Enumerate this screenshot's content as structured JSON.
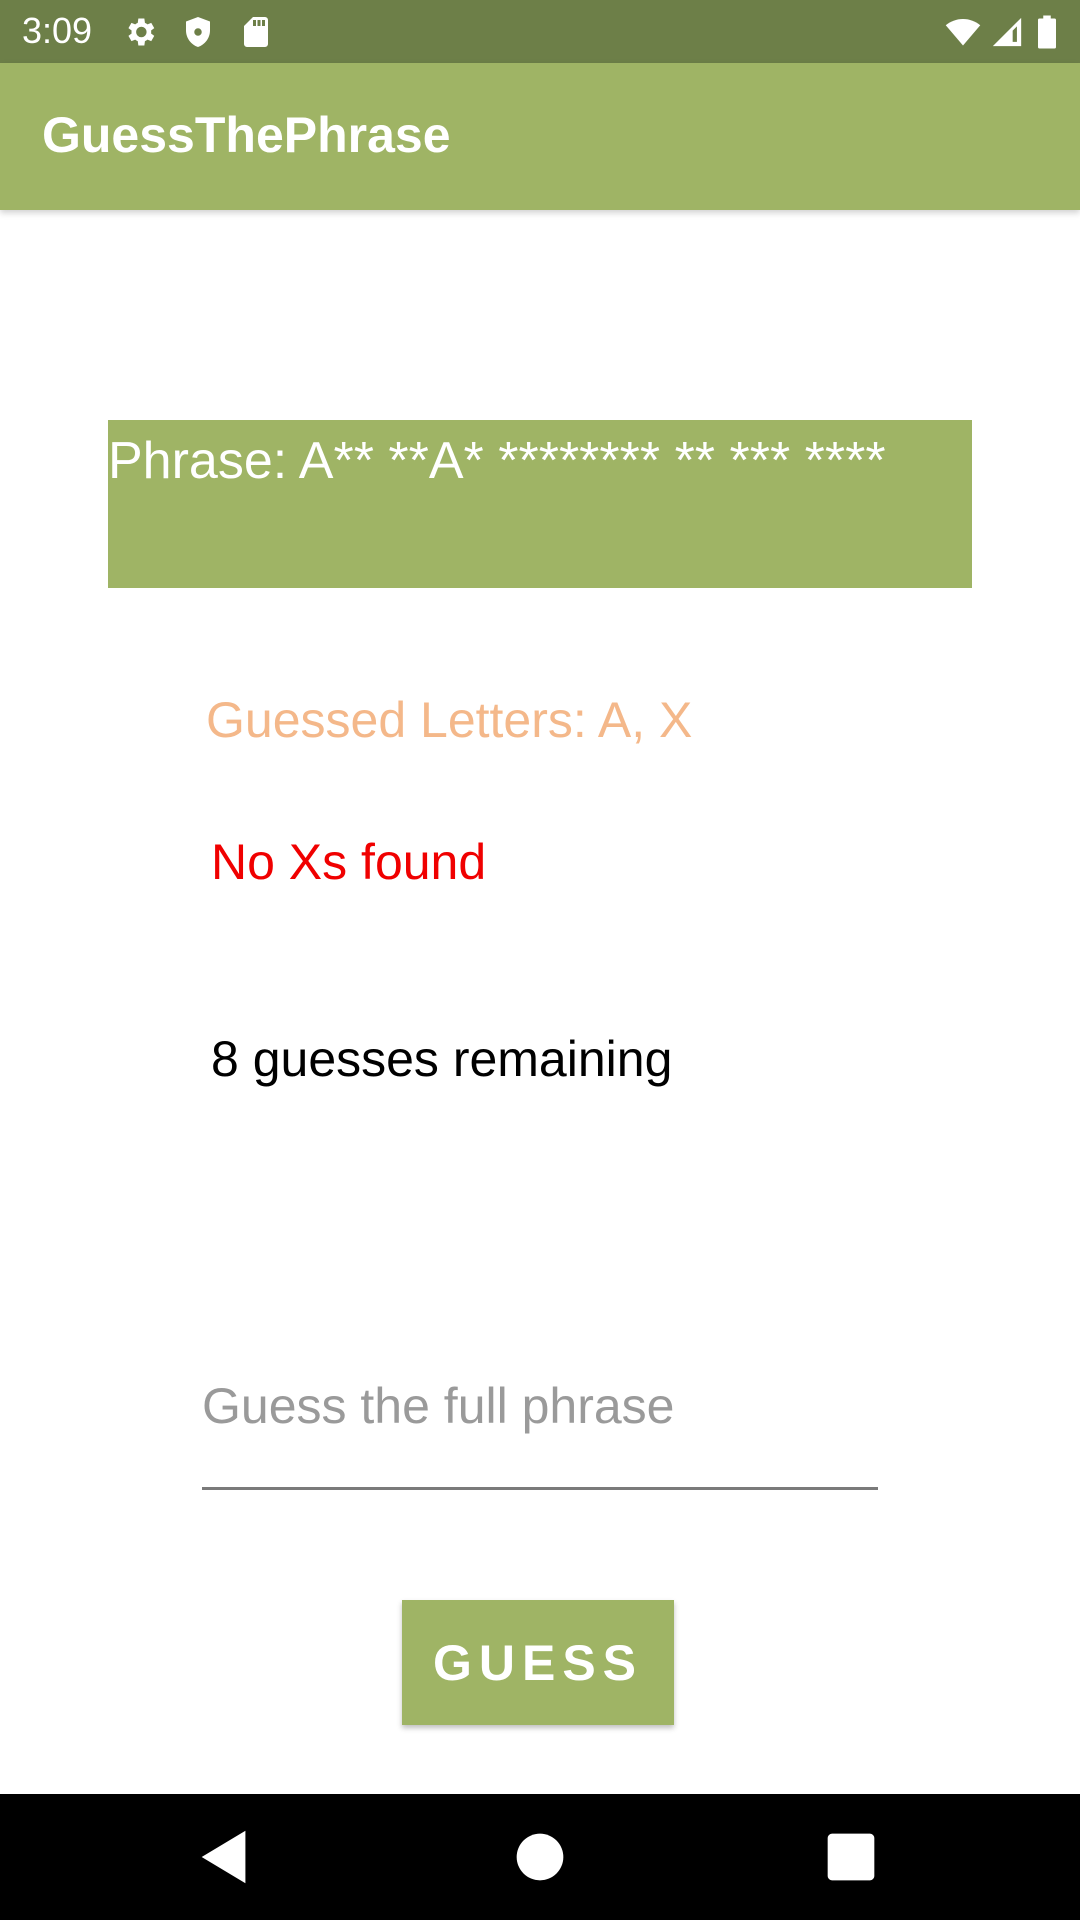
{
  "status_bar": {
    "time": "3:09",
    "left_icons": [
      "settings-gear-icon",
      "shield-icon",
      "sd-card-icon"
    ],
    "right_icons": [
      "wifi-icon",
      "cell-signal-icon",
      "battery-icon"
    ],
    "background_color": "#6d7f48"
  },
  "app_bar": {
    "title": "GuessThePhrase",
    "background_color": "#9fb465"
  },
  "game": {
    "phrase_display": "Phrase: A** **A* ******** ** *** ****",
    "guessed_letters": "Guessed Letters: A, X",
    "message": "No Xs found",
    "guesses_remaining": "8 guesses remaining",
    "accent_color": "#9fb465",
    "guessed_color": "#f4b88a",
    "message_color": "#f00000"
  },
  "input": {
    "value": "",
    "placeholder": "Guess the full phrase"
  },
  "button": {
    "label": "GUESS"
  },
  "nav_bar": {
    "buttons": [
      "back-icon",
      "home-icon",
      "recents-icon"
    ]
  }
}
